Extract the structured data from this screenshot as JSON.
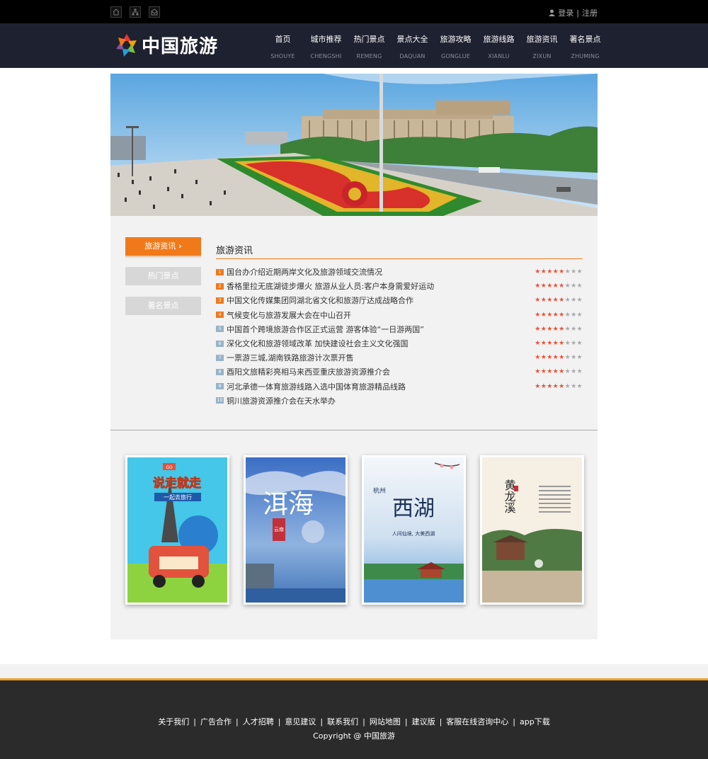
{
  "topbar": {
    "login": "登录",
    "divider": "|",
    "register": "注册"
  },
  "brand": {
    "name": "中国旅游"
  },
  "nav": [
    {
      "cn": "首页",
      "en": "SHOUYE"
    },
    {
      "cn": "城市推荐",
      "en": "CHENGSHI"
    },
    {
      "cn": "热门景点",
      "en": "REMENG"
    },
    {
      "cn": "景点大全",
      "en": "DAQUAN"
    },
    {
      "cn": "旅游攻略",
      "en": "GONGLUE"
    },
    {
      "cn": "旅游线路",
      "en": "XIANLU"
    },
    {
      "cn": "旅游资讯",
      "en": "ZIXUN"
    },
    {
      "cn": "著名景点",
      "en": "ZHUMING"
    }
  ],
  "sidebar": {
    "items": [
      {
        "label": "旅游资讯",
        "chev": "›"
      },
      {
        "label": "热门景点"
      },
      {
        "label": "著名景点"
      }
    ]
  },
  "news": {
    "title": "旅游资讯",
    "items": [
      {
        "num": "1",
        "text": "国台办介绍近期两岸文化及旅游领域交流情况",
        "stars": 5
      },
      {
        "num": "2",
        "text": "香格里拉无底湖徒步爆火 旅游从业人员:客户本身需爱好运动",
        "stars": 5
      },
      {
        "num": "3",
        "text": "中国文化传媒集团同湖北省文化和旅游厅达成战略合作",
        "stars": 5
      },
      {
        "num": "4",
        "text": "气候变化与旅游发展大会在中山召开",
        "stars": 5
      },
      {
        "num": "5",
        "text": "中国首个跨境旅游合作区正式运营 游客体验“一日游两国”",
        "stars": 5
      },
      {
        "num": "6",
        "text": "深化文化和旅游领域改革 加快建设社会主义文化强国",
        "stars": 5
      },
      {
        "num": "7",
        "text": "一票游三城,湖南铁路旅游计次票开售",
        "stars": 5
      },
      {
        "num": "8",
        "text": "酉阳文旅精彩亮相马来西亚重庆旅游资源推介会",
        "stars": 5
      },
      {
        "num": "9",
        "text": "河北承德一体育旅游线路入选中国体育旅游精品线路",
        "stars": 5
      },
      {
        "num": "10",
        "text": "铜川旅游资源推介会在天水举办",
        "stars": 0
      }
    ]
  },
  "posters": [
    {
      "line1": "说走就走",
      "line2": "一起去旅行",
      "badge": "GO"
    },
    {
      "line1": "洱海",
      "line2": "云南"
    },
    {
      "line1": "西湖",
      "line2": "杭州",
      "line3": "人间仙境, 大美西湖"
    },
    {
      "line1": "黄龙溪"
    }
  ],
  "footer": {
    "links": [
      "关于我们",
      "广告合作",
      "人才招聘",
      "意见建议",
      "联系我们",
      "网站地图",
      "建议版",
      "客服在线咨询中心",
      "app下载"
    ],
    "copyright": "Copyright @ 中国旅游"
  },
  "colors": {
    "accent": "#f07a1a",
    "nav_bg": "#1e2230",
    "footer_bg": "#2b2b2b",
    "footer_border": "#f2a21b",
    "star": "#e95238"
  }
}
